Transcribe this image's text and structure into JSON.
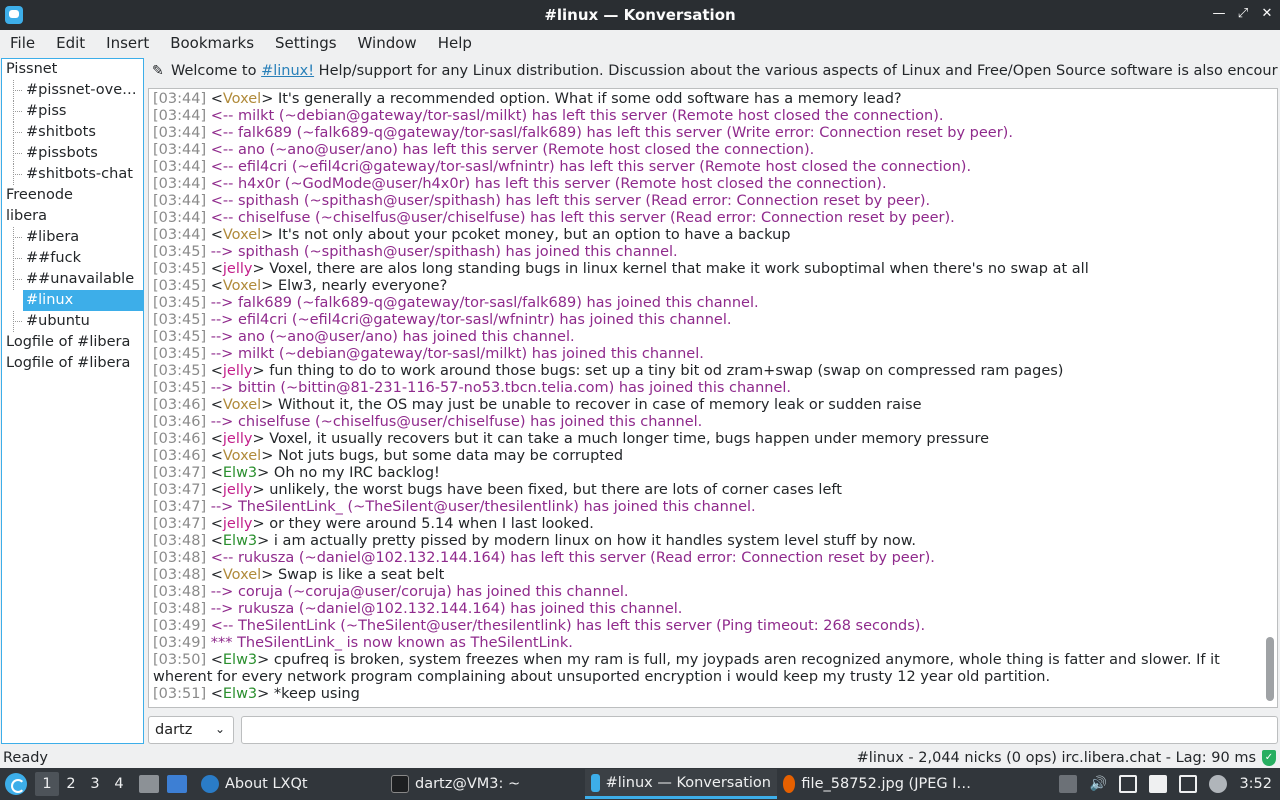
{
  "window": {
    "title": "#linux — Konversation",
    "app_icon": "konversation-icon",
    "controls": [
      "minimize-icon",
      "maximize-icon",
      "close-icon"
    ]
  },
  "menubar": [
    "File",
    "Edit",
    "Insert",
    "Bookmarks",
    "Settings",
    "Window",
    "Help"
  ],
  "sidebar": {
    "items": [
      {
        "label": "Pissnet",
        "kind": "server"
      },
      {
        "label": "#pissnet-over…",
        "kind": "channel"
      },
      {
        "label": "#piss",
        "kind": "channel"
      },
      {
        "label": "#shitbots",
        "kind": "channel"
      },
      {
        "label": "#pissbots",
        "kind": "channel"
      },
      {
        "label": "#shitbots-chat",
        "kind": "channel"
      },
      {
        "label": "Freenode",
        "kind": "server"
      },
      {
        "label": "libera",
        "kind": "server"
      },
      {
        "label": "#libera",
        "kind": "channel"
      },
      {
        "label": "##fuck",
        "kind": "channel"
      },
      {
        "label": "##unavailable",
        "kind": "channel"
      },
      {
        "label": "#linux",
        "kind": "channel",
        "selected": true
      },
      {
        "label": "#ubuntu",
        "kind": "channel"
      },
      {
        "label": "Logfile of #libera",
        "kind": "server"
      },
      {
        "label": "Logfile of #libera",
        "kind": "server"
      }
    ]
  },
  "topic": {
    "icon": "pencil-icon",
    "prefix": "Welcome to ",
    "link": "#linux!",
    "rest": " Help/support for any Linux distribution. Discussion about the various aspects of Linux and Free/Open Source software is also encouraged. ..."
  },
  "chat": {
    "lines": [
      {
        "ts": "[03:44]",
        "nick": "Voxel",
        "text": "It's generally a recommended option. What if some odd software has a memory lead?"
      },
      {
        "ts": "[03:44]",
        "event": "<-- milkt (~debian@gateway/tor-sasl/milkt) has left this server (Remote host closed the connection)."
      },
      {
        "ts": "[03:44]",
        "event": "<-- falk689 (~falk689-q@gateway/tor-sasl/falk689) has left this server (Write error: Connection reset by peer)."
      },
      {
        "ts": "[03:44]",
        "event": "<-- ano (~ano@user/ano) has left this server (Remote host closed the connection)."
      },
      {
        "ts": "[03:44]",
        "event": "<-- efil4cri (~efil4cri@gateway/tor-sasl/wfnintr) has left this server (Remote host closed the connection)."
      },
      {
        "ts": "[03:44]",
        "event": "<-- h4x0r (~GodMode@user/h4x0r) has left this server (Remote host closed the connection)."
      },
      {
        "ts": "[03:44]",
        "event": "<-- spithash (~spithash@user/spithash) has left this server (Read error: Connection reset by peer)."
      },
      {
        "ts": "[03:44]",
        "event": "<-- chiselfuse (~chiselfus@user/chiselfuse) has left this server (Read error: Connection reset by peer)."
      },
      {
        "ts": "[03:44]",
        "nick": "Voxel",
        "text": "It's not only about your pcoket money, but an option to have a backup"
      },
      {
        "ts": "[03:45]",
        "event": "--> spithash (~spithash@user/spithash) has joined this channel."
      },
      {
        "ts": "[03:45]",
        "nick": "jelly",
        "text": "Voxel, there are alos long standing bugs in linux kernel that make it work suboptimal when there's no swap at all"
      },
      {
        "ts": "[03:45]",
        "nick": "Voxel",
        "text": "Elw3, nearly everyone?"
      },
      {
        "ts": "[03:45]",
        "event": "--> falk689 (~falk689-q@gateway/tor-sasl/falk689) has joined this channel."
      },
      {
        "ts": "[03:45]",
        "event": "--> efil4cri (~efil4cri@gateway/tor-sasl/wfnintr) has joined this channel."
      },
      {
        "ts": "[03:45]",
        "event": "--> ano (~ano@user/ano) has joined this channel."
      },
      {
        "ts": "[03:45]",
        "event": "--> milkt (~debian@gateway/tor-sasl/milkt) has joined this channel."
      },
      {
        "ts": "[03:45]",
        "nick": "jelly",
        "text": "fun thing to do to work around those bugs: set up a tiny bit od zram+swap (swap on compressed ram pages)"
      },
      {
        "ts": "[03:45]",
        "event": "--> bittin (~bittin@81-231-116-57-no53.tbcn.telia.com) has joined this channel."
      },
      {
        "ts": "[03:46]",
        "nick": "Voxel",
        "text": "Without it, the OS may just be unable to recover in case of memory leak or sudden raise"
      },
      {
        "ts": "[03:46]",
        "event": "--> chiselfuse (~chiselfus@user/chiselfuse) has joined this channel."
      },
      {
        "ts": "[03:46]",
        "nick": "jelly",
        "text": "Voxel, it usually recovers but it can take a much longer time, bugs happen under memory pressure"
      },
      {
        "ts": "[03:46]",
        "nick": "Voxel",
        "text": "Not juts bugs, but some data may be corrupted"
      },
      {
        "ts": "[03:47]",
        "nick": "Elw3",
        "text": "Oh no my IRC backlog!"
      },
      {
        "ts": "[03:47]",
        "nick": "jelly",
        "text": "unlikely, the worst bugs have been fixed, but there are lots of corner cases left"
      },
      {
        "ts": "[03:47]",
        "event": "--> TheSilentLink_ (~TheSilent@user/thesilentlink) has joined this channel."
      },
      {
        "ts": "[03:47]",
        "nick": "jelly",
        "text": "or they were around 5.14 when I last looked."
      },
      {
        "ts": "[03:48]",
        "nick": "Elw3",
        "text": "i am actually pretty pissed by modern linux on how it handles system level stuff by now."
      },
      {
        "ts": "[03:48]",
        "event": "<-- rukusza (~daniel@102.132.144.164) has left this server (Read error: Connection reset by peer)."
      },
      {
        "ts": "[03:48]",
        "nick": "Voxel",
        "text": "Swap is like a seat belt"
      },
      {
        "ts": "[03:48]",
        "event": "--> coruja (~coruja@user/coruja) has joined this channel."
      },
      {
        "ts": "[03:48]",
        "event": "--> rukusza (~daniel@102.132.144.164) has joined this channel."
      },
      {
        "ts": "[03:49]",
        "event": "<-- TheSilentLink (~TheSilent@user/thesilentlink) has left this server (Ping timeout: 268 seconds)."
      },
      {
        "ts": "[03:49]",
        "event": "*** TheSilentLink_ is now known as TheSilentLink."
      },
      {
        "ts": "[03:50]",
        "nick": "Elw3",
        "text": "cpufreq is broken, system freezes when my ram is full, my joypads aren recognized anymore, whole thing is fatter and slower. If it wherent for every network program complaining about unsuported encryption i would keep my trusty 12 year old partition.",
        "wrap": true
      },
      {
        "ts": "[03:51]",
        "nick": "Elw3",
        "text": "*keep using"
      }
    ]
  },
  "input": {
    "nick": "dartz",
    "message": ""
  },
  "statusbar": {
    "left": "Ready",
    "right": "#linux - 2,044 nicks (0 ops)  irc.libera.chat - Lag: 90 ms",
    "icon": "shield-check-icon"
  },
  "taskbar": {
    "desktops": [
      "1",
      "2",
      "3",
      "4"
    ],
    "tasks": [
      {
        "label": "About LXQt",
        "icon": "lxqt-icon"
      },
      {
        "label": "dartz@VM3: ~",
        "icon": "terminal-icon"
      },
      {
        "label": "#linux — Konversation",
        "icon": "konversation-icon",
        "active": true
      },
      {
        "label": "file_58752.jpg (JPEG I…",
        "icon": "firefox-icon"
      }
    ],
    "clock": "3:52"
  }
}
